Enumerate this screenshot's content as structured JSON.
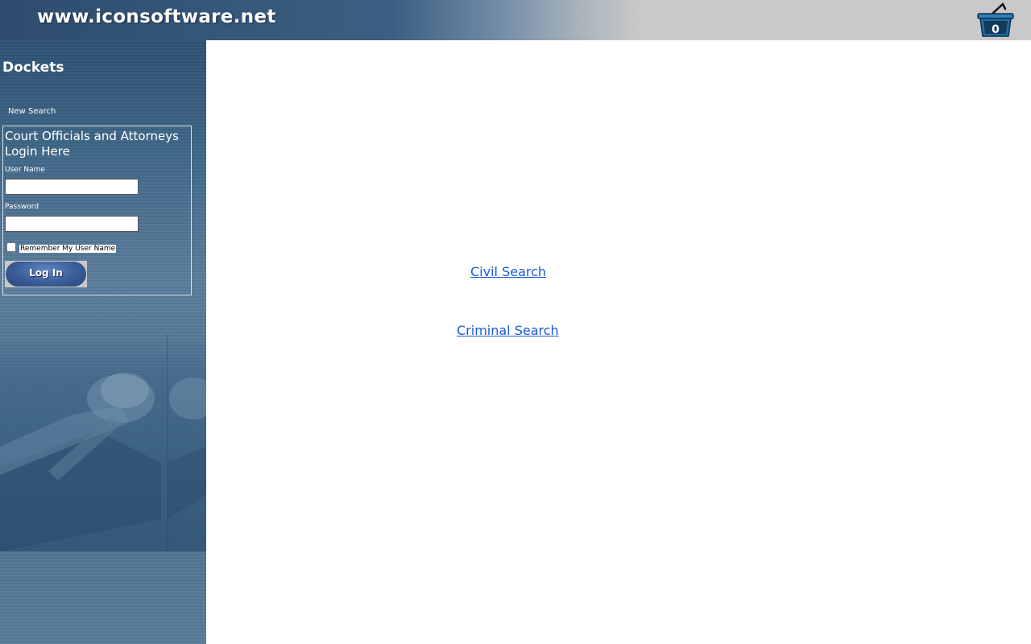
{
  "header": {
    "site_title": "www.iconsoftware.net",
    "cart_count": "0",
    "cart_icon": "shopping-basket-icon"
  },
  "sidebar": {
    "heading": "Dockets",
    "new_search_label": "New Search",
    "login": {
      "title": "Court Officials and Attorneys Login Here",
      "username_label": "User Name",
      "username_value": "",
      "password_label": "Password",
      "password_value": "",
      "remember_label": "Remember My User Name",
      "remember_checked": false,
      "button_label": "Log In"
    }
  },
  "main": {
    "links": {
      "civil": "Civil Search",
      "criminal": "Criminal Search"
    }
  },
  "colors": {
    "sidebar_bg": "#4a7090",
    "link": "#1a5bd3",
    "login_button": "#3a5d98"
  }
}
